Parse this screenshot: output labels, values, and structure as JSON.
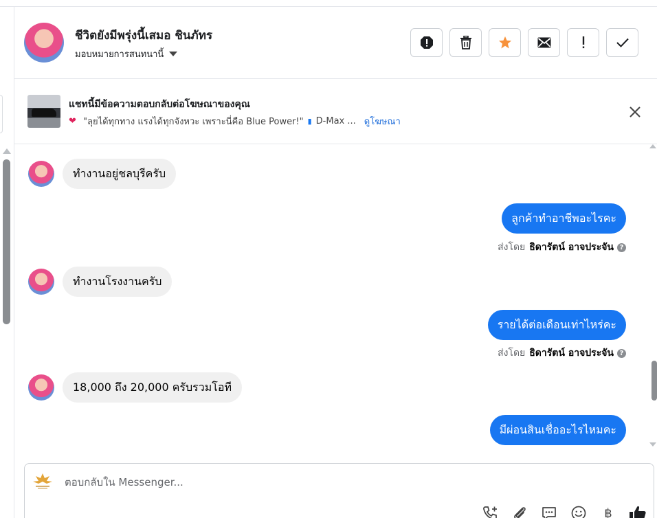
{
  "header": {
    "contact_name": "ชีวิตยังมีพรุ่งนี้เสมอ ชินภัทร",
    "assign_label": "มอบหมายการสนทนานี้"
  },
  "ad_banner": {
    "title": "แชทนี้มีข้อความตอบกลับต่อโฆษณาของคุณ",
    "ad_text": "\"ลุยได้ทุกทาง แรงได้ทุกจังหวะ เพราะนี่คือ Blue Power!\"",
    "ad_model": "D-Max ...",
    "view_ad_link": "ดูโฆษณา"
  },
  "messages": [
    {
      "direction": "in",
      "text": "ทำงานอยู่ชลบุรีครับ"
    },
    {
      "direction": "out",
      "text": "ลูกค้าทำอาชีพอะไรคะ",
      "sent_by_label": "ส่งโดย",
      "sender": "ธิดารัตน์ อาจประจัน"
    },
    {
      "direction": "in",
      "text": "ทำงานโรงงานครับ"
    },
    {
      "direction": "out",
      "text": "รายได้ต่อเดือนเท่าไหร่คะ",
      "sent_by_label": "ส่งโดย",
      "sender": "ธิดารัตน์ อาจประจัน"
    },
    {
      "direction": "in",
      "text": "18,000 ถึง 20,000 ครับรวมโอที"
    },
    {
      "direction": "out",
      "text": "มีผ่อนสินเชื่ออะไรไหมคะ"
    }
  ],
  "composer": {
    "placeholder": "ตอบกลับใน Messenger..."
  },
  "colors": {
    "accent": "#1877f2",
    "star": "#f7923b",
    "incoming_bubble": "#f0f0f0"
  },
  "icons": [
    "spam-icon",
    "trash-icon",
    "star-icon",
    "mail-icon",
    "exclamation-icon",
    "check-icon",
    "close-icon",
    "phone-add-icon",
    "paperclip-icon",
    "message-bubble-icon",
    "emoji-icon",
    "baht-icon",
    "thumbs-up-icon"
  ]
}
